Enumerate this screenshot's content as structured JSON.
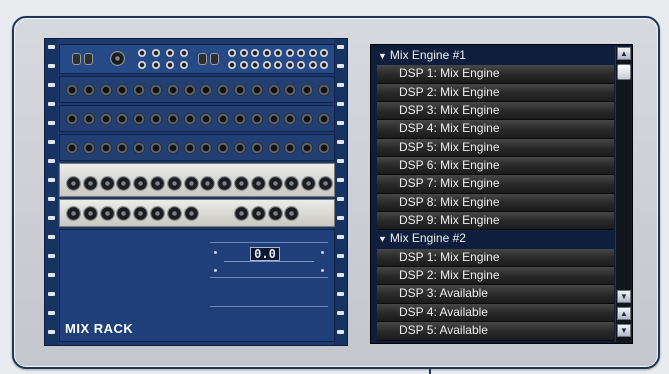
{
  "rack": {
    "label": "MIX RACK",
    "module_display": "0.0"
  },
  "dsp_list": {
    "rows": [
      {
        "type": "header",
        "label": "Mix Engine #1"
      },
      {
        "type": "item",
        "label": "DSP 1: Mix Engine"
      },
      {
        "type": "item",
        "label": "DSP 2: Mix Engine"
      },
      {
        "type": "item",
        "label": "DSP 3: Mix Engine"
      },
      {
        "type": "item",
        "label": "DSP 4: Mix Engine"
      },
      {
        "type": "item",
        "label": "DSP 5: Mix Engine"
      },
      {
        "type": "item",
        "label": "DSP 6: Mix Engine"
      },
      {
        "type": "item",
        "label": "DSP 7: Mix Engine"
      },
      {
        "type": "item",
        "label": "DSP 8: Mix Engine"
      },
      {
        "type": "item",
        "label": "DSP 9: Mix Engine"
      },
      {
        "type": "header",
        "label": "Mix Engine #2"
      },
      {
        "type": "item",
        "label": "DSP 1: Mix Engine"
      },
      {
        "type": "item",
        "label": "DSP 2: Mix Engine"
      },
      {
        "type": "item",
        "label": "DSP 3: Available"
      },
      {
        "type": "item",
        "label": "DSP 4: Available"
      },
      {
        "type": "item",
        "label": "DSP 5: Available"
      }
    ],
    "scroll_icons": [
      "scroll-up-icon",
      "scroll-down-icon",
      "page-up-icon",
      "page-down-icon"
    ]
  },
  "colors": {
    "frame_border": "#1d3559",
    "rack_blue": "#1c3a70",
    "list_bg": "#0e1e3c",
    "row_text": "#f0f0f0"
  }
}
